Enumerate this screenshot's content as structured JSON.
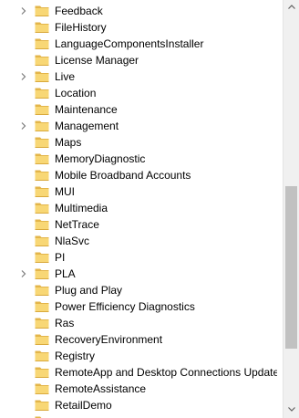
{
  "tree": {
    "items": [
      {
        "label": "Feedback",
        "expandable": true
      },
      {
        "label": "FileHistory",
        "expandable": false
      },
      {
        "label": "LanguageComponentsInstaller",
        "expandable": false
      },
      {
        "label": "License Manager",
        "expandable": false
      },
      {
        "label": "Live",
        "expandable": true
      },
      {
        "label": "Location",
        "expandable": false
      },
      {
        "label": "Maintenance",
        "expandable": false
      },
      {
        "label": "Management",
        "expandable": true
      },
      {
        "label": "Maps",
        "expandable": false
      },
      {
        "label": "MemoryDiagnostic",
        "expandable": false
      },
      {
        "label": "Mobile Broadband Accounts",
        "expandable": false
      },
      {
        "label": "MUI",
        "expandable": false
      },
      {
        "label": "Multimedia",
        "expandable": false
      },
      {
        "label": "NetTrace",
        "expandable": false
      },
      {
        "label": "NlaSvc",
        "expandable": false
      },
      {
        "label": "PI",
        "expandable": false
      },
      {
        "label": "PLA",
        "expandable": true
      },
      {
        "label": "Plug and Play",
        "expandable": false
      },
      {
        "label": "Power Efficiency Diagnostics",
        "expandable": false
      },
      {
        "label": "Ras",
        "expandable": false
      },
      {
        "label": "RecoveryEnvironment",
        "expandable": false
      },
      {
        "label": "Registry",
        "expandable": false
      },
      {
        "label": "RemoteApp and Desktop Connections Update",
        "expandable": false
      },
      {
        "label": "RemoteAssistance",
        "expandable": false
      },
      {
        "label": "RetailDemo",
        "expandable": false
      },
      {
        "label": "",
        "expandable": false
      }
    ],
    "folder_icon": "folder-icon",
    "expand_icon": "chevron-right-icon"
  },
  "scrollbar": {
    "thumb_start": 0.44,
    "thumb_end": 0.86
  },
  "colors": {
    "folder_body": "#f8d775",
    "folder_back": "#e3b54a",
    "chevron": "#7a7a7a",
    "scroll_track": "#f0f0f0",
    "scroll_thumb": "#c1c1c1"
  }
}
